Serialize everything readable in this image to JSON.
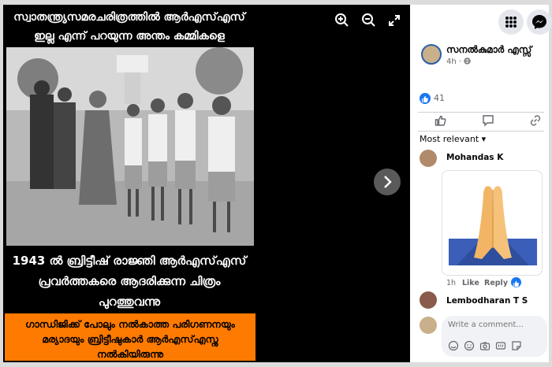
{
  "poster": {
    "top_line1": "സ്വാതന്ത്ര്യസമരചരിത്രത്തിൽ ആർഎസ്എസ്",
    "top_line2": "ഇല്ല എന്ന് പറയുന്ന അന്തം കമ്മികളെ",
    "mid_line1": "1943 ൽ ബ്രിട്ടീഷ് രാജ്ഞി ആർഎസ്എസ്",
    "mid_line2": "പ്രവർത്തകരെ ആദരിക്കുന്ന ചിത്രം",
    "mid_line3": "പുറത്തുവന്നു",
    "bottom_line1": "ഗാന്ധിജിക്ക് പോലും നൽകാത്ത പരിഗണനയും",
    "bottom_line2": "മര്യാദയും ബ്രിട്ടീഷുകാർ ആർഎസ്എസ്നു",
    "bottom_line3": "നൽകിയിരുന്നു"
  },
  "post": {
    "author": "സനൽകുമാർ എസ്സ്",
    "time": "4h ·",
    "like_count": "41"
  },
  "comments": {
    "sort_label": "Most relevant ▾",
    "items": [
      {
        "name": "Mohandas K",
        "age": "1h",
        "like": "Like",
        "reply": "Reply"
      },
      {
        "name": "Lembodharan T S"
      }
    ]
  },
  "composer": {
    "placeholder": "Write a comment..."
  },
  "colors": {
    "accent": "#1877f2",
    "orange_band": "#ff7a00"
  },
  "icons": [
    "zoom-in-icon",
    "zoom-out-icon",
    "fullscreen-icon",
    "chevron-right-icon",
    "apps-grid-icon",
    "messenger-icon",
    "globe-icon",
    "like-icon",
    "comment-icon",
    "share-icon",
    "emoji-icon",
    "camera-icon",
    "gif-icon",
    "sticker-icon"
  ]
}
